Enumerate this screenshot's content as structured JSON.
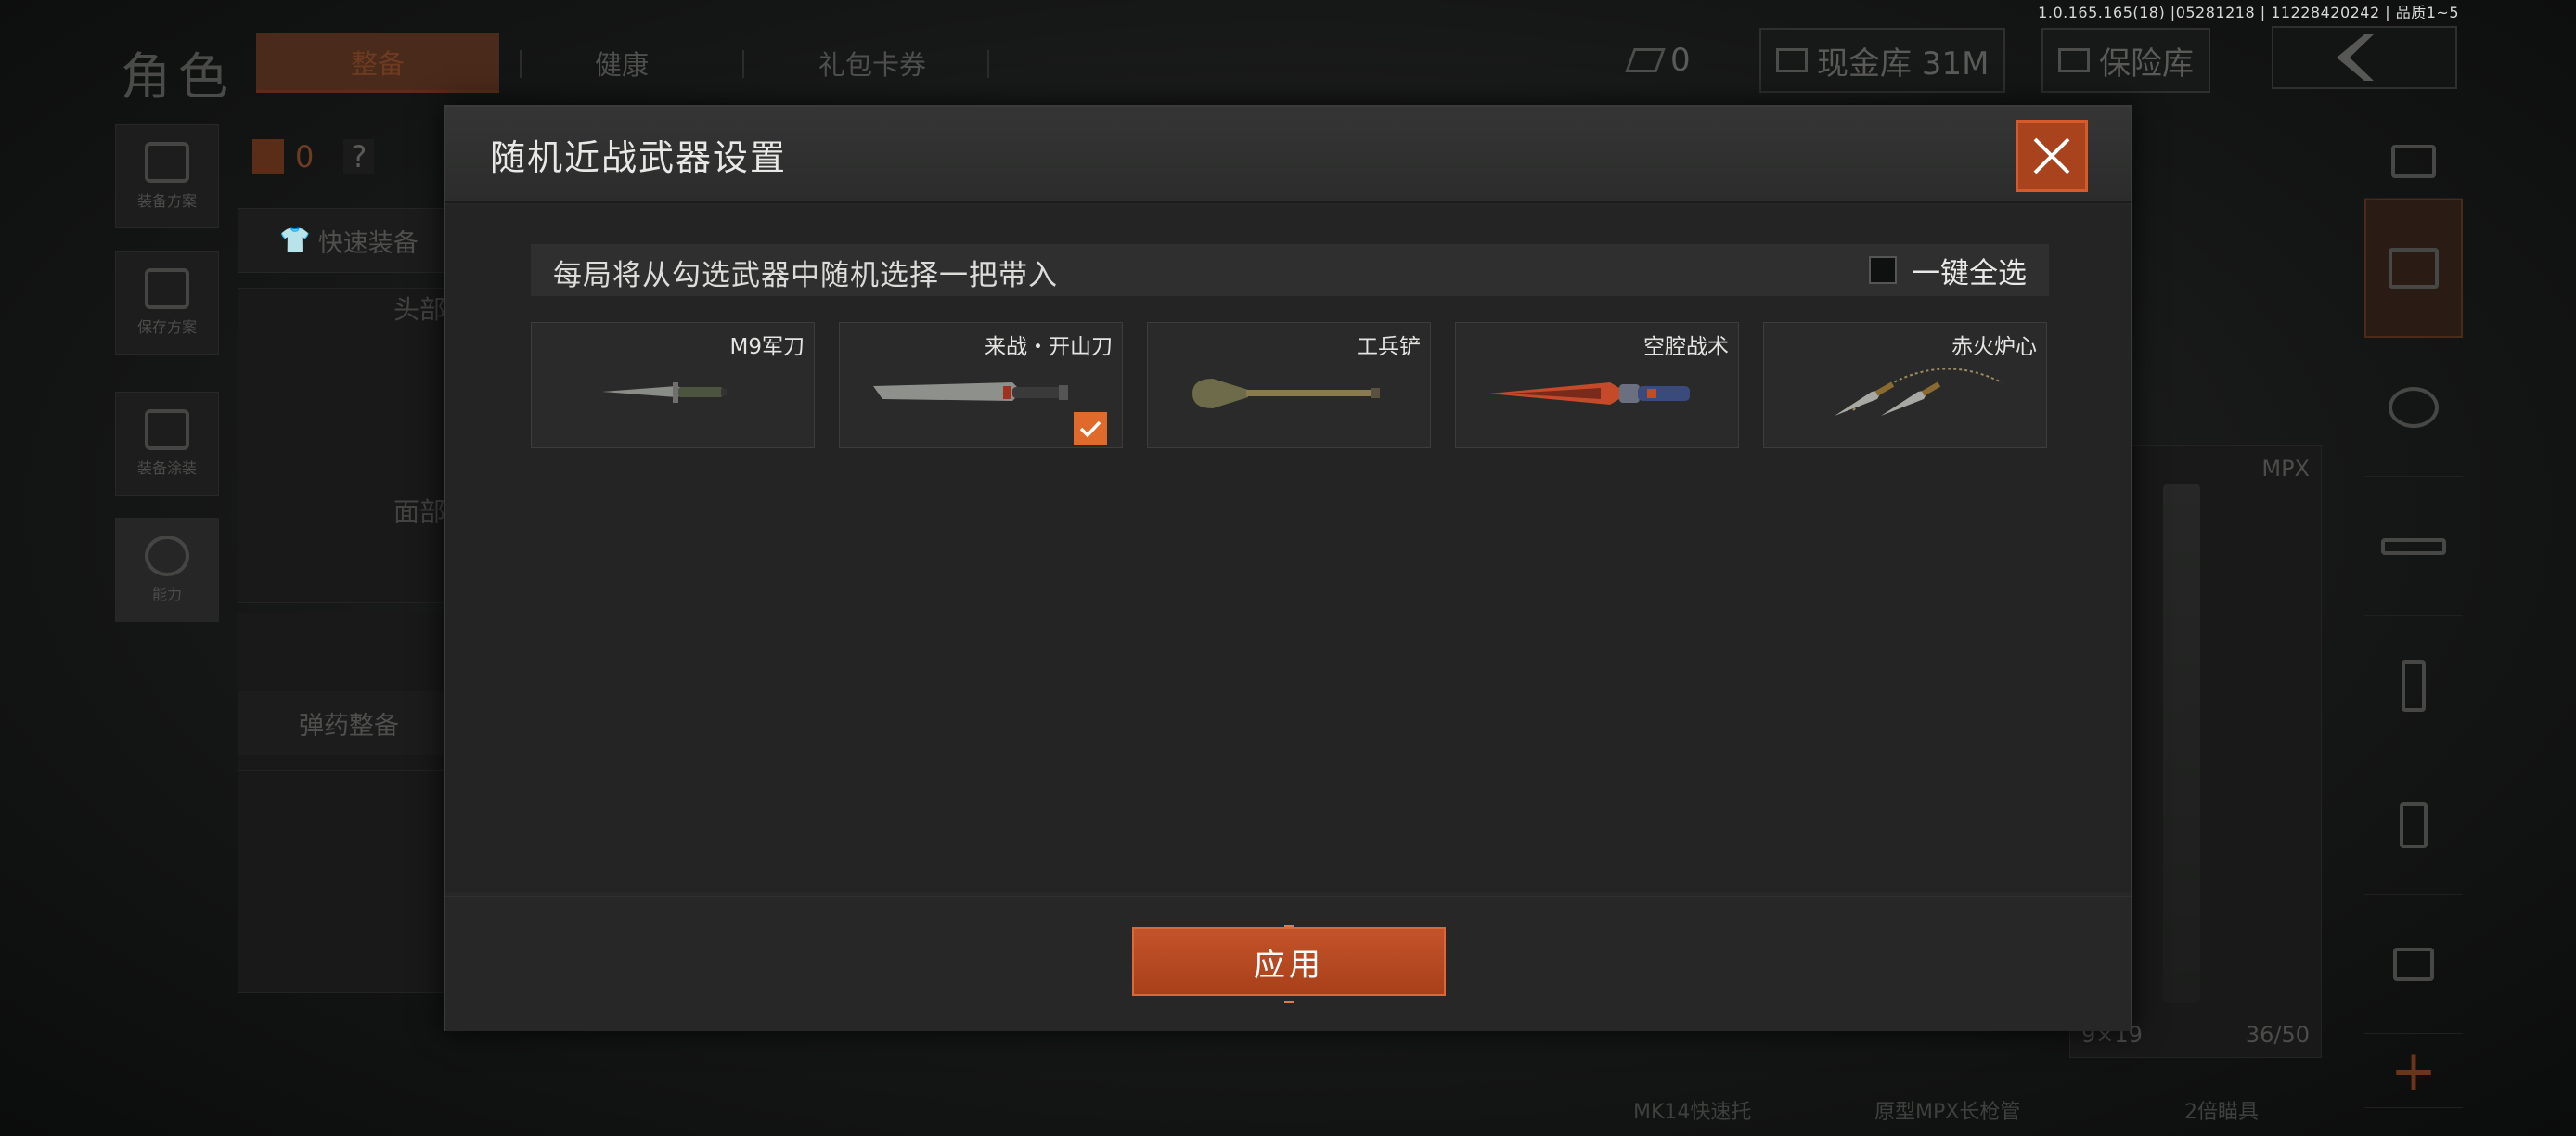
{
  "version": "1.0.165.165(18) |05281218 | 11228420242 | 品质1~5",
  "header": {
    "title": "角色",
    "tabs": [
      {
        "label": "整备"
      },
      {
        "label": "健康"
      },
      {
        "label": "礼包卡券"
      }
    ],
    "ticket_count": "0",
    "cash_vault": "现金库 31M",
    "insurance_vault": "保险库"
  },
  "left_nav": [
    {
      "label": "装备方案"
    },
    {
      "label": "保存方案"
    },
    {
      "label": "装备涂装"
    },
    {
      "label": "能力"
    }
  ],
  "left_panel": {
    "backpack_count": "0",
    "help": "?",
    "quick_equip": "快速装备",
    "head_label": "头部",
    "face_label": "面部",
    "ammo_label": "弹药整备"
  },
  "weapon_card": {
    "name": "MPX",
    "ammo_type": "9×19",
    "ammo_count": "36/50"
  },
  "bottom_strip": {
    "item_left": "MK14快速托",
    "item_mid": "原型MPX长枪管",
    "item_right": "2倍瞄具"
  },
  "modal": {
    "title": "随机近战武器设置",
    "info": "每局将从勾选武器中随机选择一把带入",
    "select_all": "一键全选",
    "select_all_checked": false,
    "weapons": [
      {
        "name": "M9军刀",
        "checked": false,
        "icon": "bayonet-knife"
      },
      {
        "name": "来战・开山刀",
        "checked": true,
        "icon": "machete"
      },
      {
        "name": "工兵铲",
        "checked": false,
        "icon": "shovel"
      },
      {
        "name": "空腔战术",
        "checked": false,
        "icon": "tactical-blade"
      },
      {
        "name": "赤火炉心",
        "checked": false,
        "icon": "twin-kunai"
      }
    ],
    "apply": "应用"
  },
  "colors": {
    "accent": "#d65a2a",
    "check": "#e06a2c",
    "modal_bg": "#262726"
  }
}
